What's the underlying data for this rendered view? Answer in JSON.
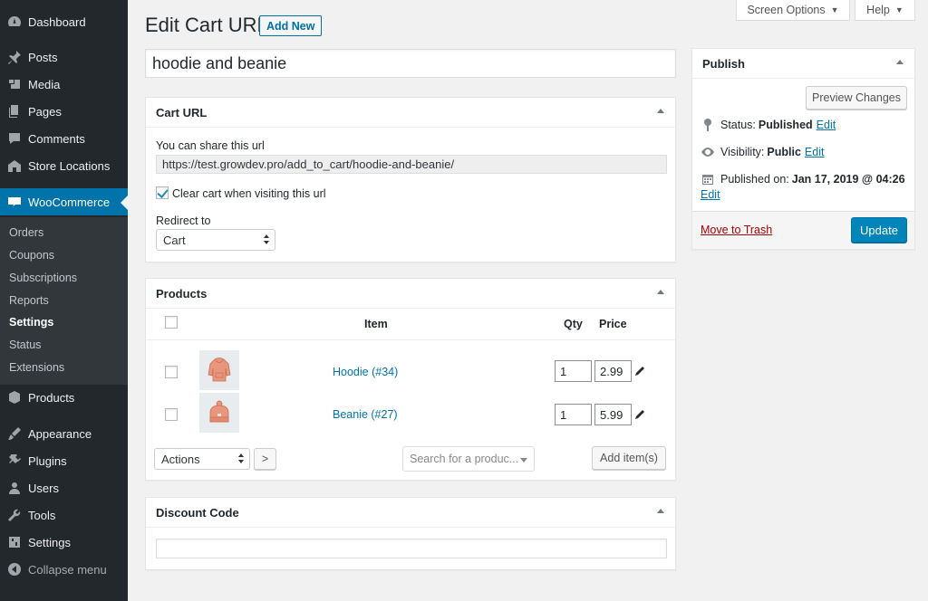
{
  "sidebar": {
    "items": [
      {
        "label": "Dashboard",
        "icon": "dashboard-icon"
      },
      {
        "label": "Posts",
        "icon": "pin-icon"
      },
      {
        "label": "Media",
        "icon": "media-icon"
      },
      {
        "label": "Pages",
        "icon": "pages-icon"
      },
      {
        "label": "Comments",
        "icon": "comments-icon"
      },
      {
        "label": "Store Locations",
        "icon": "store-icon"
      },
      {
        "label": "WooCommerce",
        "icon": "woocommerce-icon"
      },
      {
        "label": "Products",
        "icon": "products-icon"
      },
      {
        "label": "Appearance",
        "icon": "appearance-icon"
      },
      {
        "label": "Plugins",
        "icon": "plugins-icon"
      },
      {
        "label": "Users",
        "icon": "users-icon"
      },
      {
        "label": "Tools",
        "icon": "tools-icon"
      },
      {
        "label": "Settings",
        "icon": "settings-icon"
      },
      {
        "label": "Collapse menu",
        "icon": "collapse-icon"
      }
    ],
    "submenu": [
      "Orders",
      "Coupons",
      "Subscriptions",
      "Reports",
      "Settings",
      "Status",
      "Extensions"
    ],
    "active_item": "WooCommerce",
    "current_submenu": "Settings"
  },
  "top": {
    "screen_options": "Screen Options",
    "help": "Help"
  },
  "page": {
    "title": "Edit Cart URL",
    "add_new": "Add New",
    "post_title": "hoodie and beanie"
  },
  "cart_url": {
    "heading": "Cart URL",
    "share_label": "You can share this url",
    "url": "https://test.growdev.pro/add_to_cart/hoodie-and-beanie/",
    "clear_cart_label": "Clear cart when visiting this url",
    "clear_cart_checked": true,
    "redirect_label": "Redirect to",
    "redirect_value": "Cart"
  },
  "products": {
    "heading": "Products",
    "columns": {
      "item": "Item",
      "qty": "Qty",
      "price": "Price"
    },
    "rows": [
      {
        "name": "Hoodie (#34)",
        "qty": "1",
        "price": "2.99",
        "thumb": "hoodie-thumbnail"
      },
      {
        "name": "Beanie (#27)",
        "qty": "1",
        "price": "5.99",
        "thumb": "beanie-thumbnail"
      }
    ],
    "actions_value": "Actions",
    "apply_label": ">",
    "search_placeholder": "Search for a produc...",
    "add_items_label": "Add item(s)"
  },
  "discount": {
    "heading": "Discount Code",
    "value": ""
  },
  "publish": {
    "heading": "Publish",
    "preview_label": "Preview Changes",
    "status_label": "Status:",
    "status_value": "Published",
    "visibility_label": "Visibility:",
    "visibility_value": "Public",
    "published_label": "Published on:",
    "published_value": "Jan 17, 2019 @ 04:26",
    "edit_label": "Edit",
    "trash_label": "Move to Trash",
    "update_label": "Update"
  },
  "colors": {
    "sidebar_bg": "#23282d",
    "submenu_bg": "#32373c",
    "accent": "#0073aa",
    "update_button": "#0085ba",
    "trash_link": "#a00000",
    "page_bg": "#f1f1f1",
    "thumb_product": "#e8967c"
  }
}
